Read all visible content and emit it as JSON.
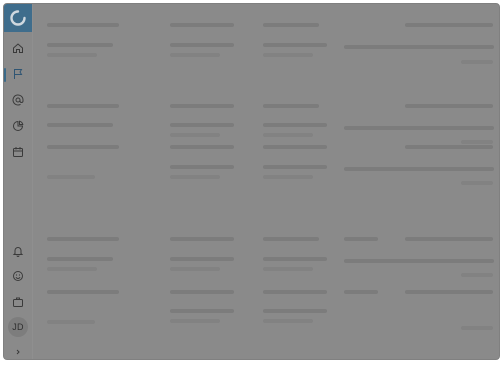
{
  "sidebar": {
    "logo_icon": "loading-spinner-logo-icon",
    "brand_color": "#3f6d8c",
    "items": [
      {
        "icon": "home-icon"
      },
      {
        "icon": "flag-icon",
        "active": true
      },
      {
        "icon": "at-sign-icon"
      },
      {
        "icon": "pie-chart-icon"
      },
      {
        "icon": "calendar-icon"
      }
    ],
    "bottom_items": [
      {
        "icon": "bell-icon"
      },
      {
        "icon": "smiley-icon"
      },
      {
        "icon": "briefcase-icon"
      }
    ],
    "avatar_initials": "JD",
    "expand_icon": "chevron-right-icon"
  },
  "overlay": {
    "state": "loading-skeleton",
    "dimmed": true
  }
}
